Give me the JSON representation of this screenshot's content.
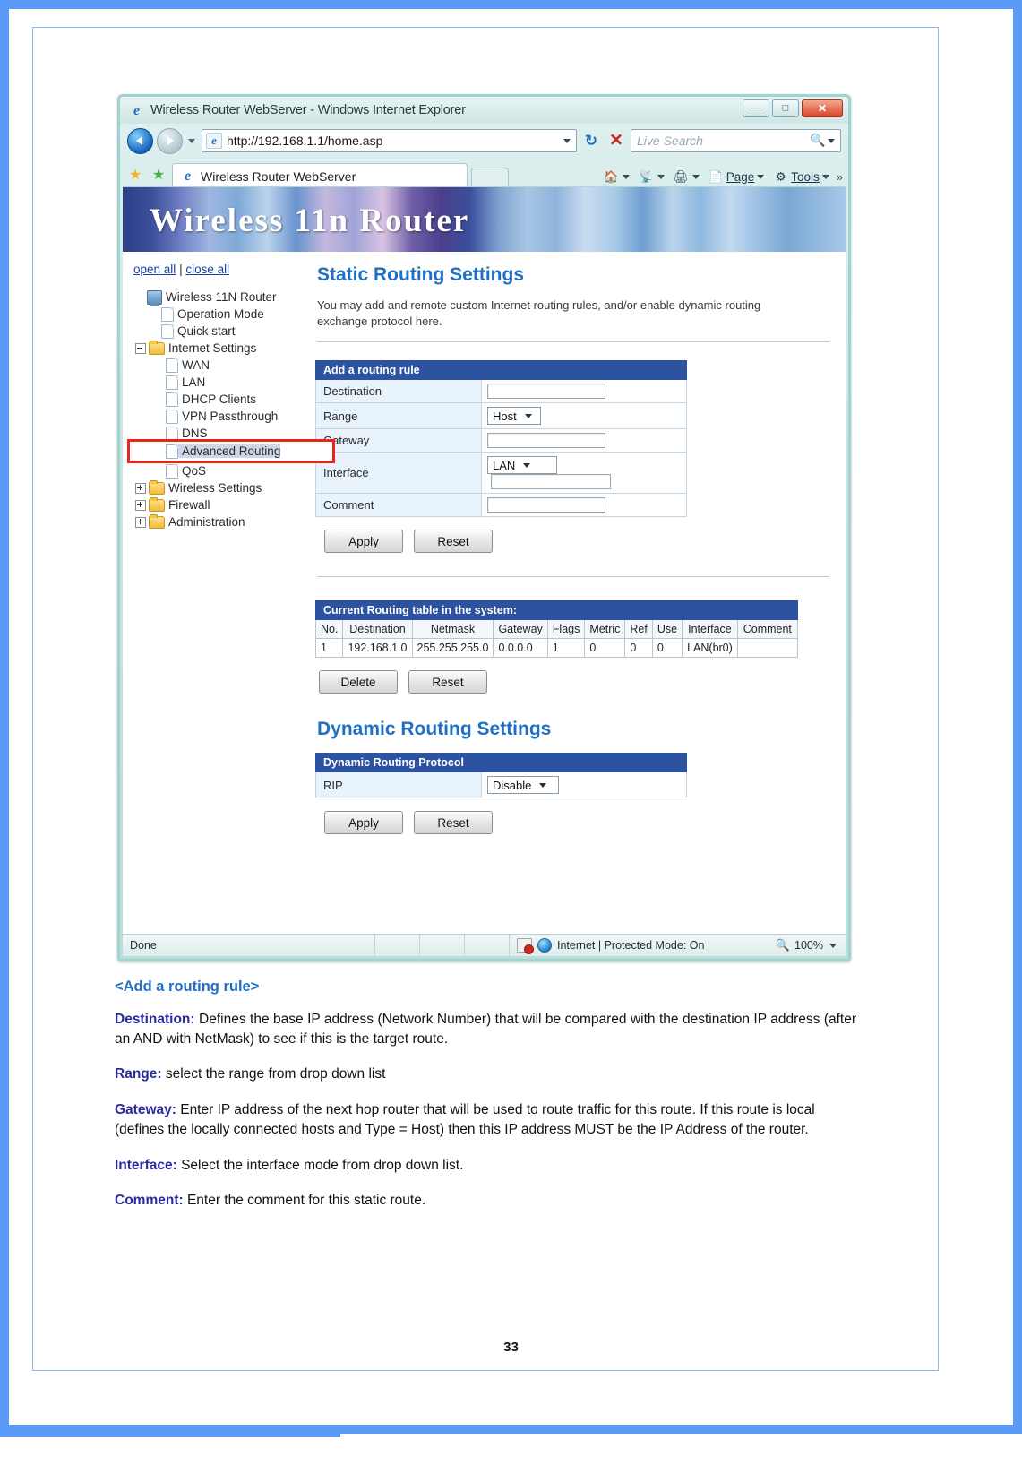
{
  "browser": {
    "title": "Wireless Router WebServer - Windows Internet Explorer",
    "url": "http://192.168.1.1/home.asp",
    "search_placeholder": "Live Search",
    "tab_label": "Wireless Router WebServer",
    "window_buttons": {
      "minimize": "—",
      "maximize": "□",
      "close": "✕"
    },
    "commands": [
      {
        "label": "",
        "icon": "home-icon"
      },
      {
        "label": "",
        "icon": "feeds-icon"
      },
      {
        "label": "",
        "icon": "print-icon"
      },
      {
        "label": "Page",
        "icon": "page-icon"
      },
      {
        "label": "Tools",
        "icon": "tools-icon"
      }
    ],
    "commands_overflow": "»",
    "status": {
      "left": "Done",
      "zone": "Internet | Protected Mode: On",
      "zoom": "100%"
    }
  },
  "router": {
    "banner_title": "Wireless 11n Router",
    "nav": {
      "open_all": "open all",
      "separator": "|",
      "close_all": "close all",
      "items": [
        {
          "label": "Wireless 11N Router",
          "indent": 0,
          "icon": "computer-icon",
          "toggle": "none",
          "state": "normal"
        },
        {
          "label": "Operation Mode",
          "indent": 1,
          "icon": "page-icon",
          "toggle": "none",
          "state": "normal"
        },
        {
          "label": "Quick start",
          "indent": 1,
          "icon": "page-icon",
          "toggle": "none",
          "state": "normal"
        },
        {
          "label": "Internet Settings",
          "indent": 1,
          "icon": "folder-icon",
          "toggle": "minus",
          "state": "normal"
        },
        {
          "label": "WAN",
          "indent": 2,
          "icon": "page-icon",
          "toggle": "none",
          "state": "normal"
        },
        {
          "label": "LAN",
          "indent": 2,
          "icon": "page-icon",
          "toggle": "none",
          "state": "normal"
        },
        {
          "label": "DHCP Clients",
          "indent": 2,
          "icon": "page-icon",
          "toggle": "none",
          "state": "normal"
        },
        {
          "label": "VPN Passthrough",
          "indent": 2,
          "icon": "page-icon",
          "toggle": "none",
          "state": "normal"
        },
        {
          "label": "DNS",
          "indent": 2,
          "icon": "page-icon",
          "toggle": "none",
          "state": "normal"
        },
        {
          "label": "Advanced Routing",
          "indent": 2,
          "icon": "page-icon",
          "toggle": "none",
          "state": "selected-highlighted"
        },
        {
          "label": "QoS",
          "indent": 2,
          "icon": "page-icon",
          "toggle": "none",
          "state": "normal"
        },
        {
          "label": "Wireless Settings",
          "indent": 1,
          "icon": "folder-icon",
          "toggle": "plus",
          "state": "normal"
        },
        {
          "label": "Firewall",
          "indent": 1,
          "icon": "folder-icon",
          "toggle": "plus",
          "state": "normal"
        },
        {
          "label": "Administration",
          "indent": 1,
          "icon": "folder-icon",
          "toggle": "plus",
          "state": "normal"
        }
      ]
    },
    "static_routing": {
      "title": "Static Routing Settings",
      "description": "You may add and remote custom Internet routing rules, and/or enable dynamic routing exchange protocol here.",
      "form_header": "Add a routing rule",
      "fields": [
        {
          "label": "Destination",
          "type": "text",
          "value": ""
        },
        {
          "label": "Range",
          "type": "select",
          "value": "Host"
        },
        {
          "label": "Gateway",
          "type": "text",
          "value": ""
        },
        {
          "label": "Interface",
          "type": "select-plus-text",
          "value": "LAN",
          "text_value": ""
        },
        {
          "label": "Comment",
          "type": "text",
          "value": ""
        }
      ],
      "apply_label": "Apply",
      "reset_label": "Reset"
    },
    "routing_table": {
      "caption": "Current Routing table in the system:",
      "columns": [
        "No.",
        "Destination",
        "Netmask",
        "Gateway",
        "Flags",
        "Metric",
        "Ref",
        "Use",
        "Interface",
        "Comment"
      ],
      "rows": [
        [
          "1",
          "192.168.1.0",
          "255.255.255.0",
          "0.0.0.0",
          "1",
          "0",
          "0",
          "0",
          "LAN(br0)",
          ""
        ]
      ],
      "delete_label": "Delete",
      "reset_label": "Reset"
    },
    "dynamic_routing": {
      "title": "Dynamic Routing Settings",
      "table_header": "Dynamic Routing Protocol",
      "rip_label": "RIP",
      "rip_value": "Disable",
      "apply_label": "Apply",
      "reset_label": "Reset"
    }
  },
  "doc": {
    "heading": "<Add a routing rule>",
    "paragraphs": [
      {
        "term": "Destination:",
        "text": " Defines the base IP address (Network Number) that will be compared with the destination IP address (after an AND with NetMask) to see if this is the target route."
      },
      {
        "term": "Range:",
        "text": " select the range from drop down list"
      },
      {
        "term": "Gateway:",
        "text": " Enter IP address of the next hop router that will be used to route traffic for this route. If this route is local (defines the locally connected hosts and Type = Host) then this IP address MUST be the IP Address of the router."
      },
      {
        "term": "Interface:",
        "text": " Select the interface mode from drop down list."
      },
      {
        "term": "Comment:",
        "text": " Enter the comment for this static route."
      }
    ],
    "page_number": "33"
  }
}
